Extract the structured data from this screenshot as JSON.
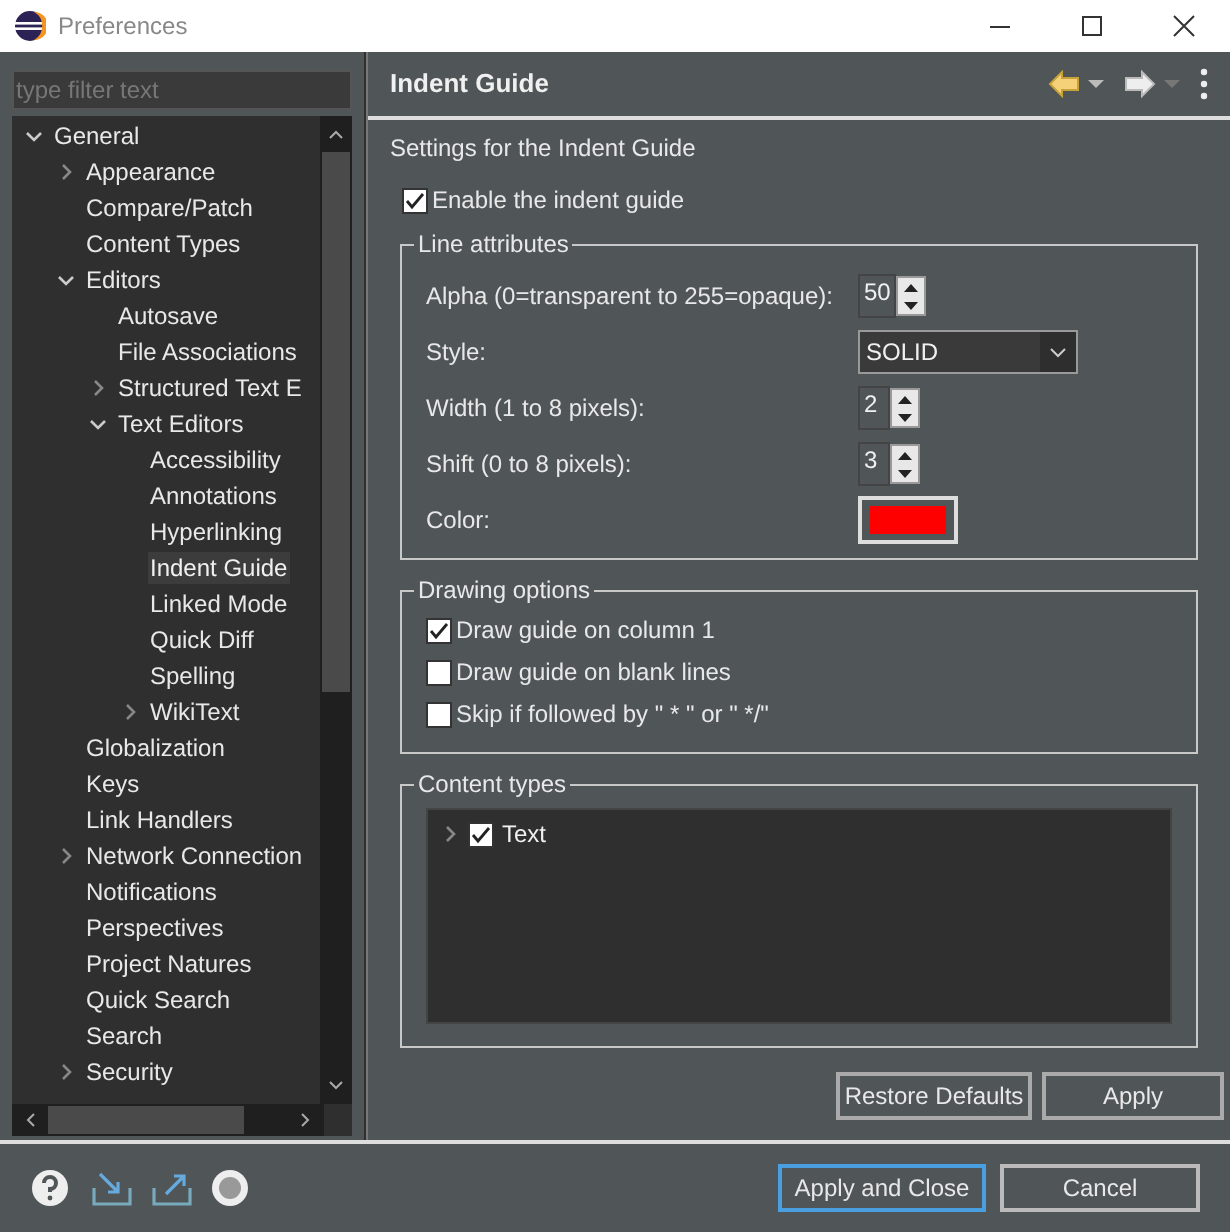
{
  "window": {
    "title": "Preferences"
  },
  "filter": {
    "placeholder": "type filter text"
  },
  "tree": [
    {
      "label": "General",
      "expanded": true,
      "selected": false,
      "children": [
        {
          "label": "Appearance",
          "expanded": false,
          "selected": false
        },
        {
          "label": "Compare/Patch",
          "selected": false
        },
        {
          "label": "Content Types",
          "selected": false
        },
        {
          "label": "Editors",
          "expanded": true,
          "selected": false,
          "children": [
            {
              "label": "Autosave",
              "selected": false
            },
            {
              "label": "File Associations",
              "selected": false
            },
            {
              "label": "Structured Text E",
              "expanded": false,
              "selected": false
            },
            {
              "label": "Text Editors",
              "expanded": true,
              "selected": false,
              "children": [
                {
                  "label": "Accessibility",
                  "selected": false
                },
                {
                  "label": "Annotations",
                  "selected": false
                },
                {
                  "label": "Hyperlinking",
                  "selected": false
                },
                {
                  "label": "Indent Guide",
                  "selected": true
                },
                {
                  "label": "Linked Mode",
                  "selected": false
                },
                {
                  "label": "Quick Diff",
                  "selected": false
                },
                {
                  "label": "Spelling",
                  "selected": false
                },
                {
                  "label": "WikiText",
                  "expanded": false,
                  "selected": false
                }
              ]
            }
          ]
        },
        {
          "label": "Globalization",
          "selected": false
        },
        {
          "label": "Keys",
          "selected": false
        },
        {
          "label": "Link Handlers",
          "selected": false
        },
        {
          "label": "Network Connection",
          "expanded": false,
          "selected": false
        },
        {
          "label": "Notifications",
          "selected": false
        },
        {
          "label": "Perspectives",
          "selected": false
        },
        {
          "label": "Project Natures",
          "selected": false
        },
        {
          "label": "Quick Search",
          "selected": false
        },
        {
          "label": "Search",
          "selected": false
        },
        {
          "label": "Security",
          "expanded": false,
          "selected": false
        }
      ]
    }
  ],
  "page": {
    "title": "Indent Guide",
    "description": "Settings for the Indent Guide",
    "enable": {
      "label": "Enable the indent guide",
      "checked": true
    },
    "line_attributes": {
      "title": "Line attributes",
      "rows": [
        {
          "kind": "spinner",
          "label": "Alpha (0=transparent to 255=opaque):",
          "value": "50"
        },
        {
          "kind": "dropdown",
          "label": "Style:",
          "value": "SOLID"
        },
        {
          "kind": "spinner",
          "label": "Width (1 to 8 pixels):",
          "value": "2"
        },
        {
          "kind": "spinner",
          "label": "Shift (0 to 8 pixels):",
          "value": "3"
        },
        {
          "kind": "color",
          "label": "Color:",
          "color": "#ff0000"
        }
      ]
    },
    "drawing_options": {
      "title": "Drawing options",
      "options": [
        {
          "label": "Draw guide on column 1",
          "checked": true
        },
        {
          "label": "Draw guide on blank lines",
          "checked": false
        },
        {
          "label": "Skip if followed by \" * \" or \" */\"",
          "checked": false
        }
      ]
    },
    "content_types": {
      "title": "Content types",
      "items": [
        {
          "label": "Text",
          "checked": true,
          "expanded": false
        }
      ]
    },
    "buttons": [
      "Restore Defaults",
      "Apply"
    ]
  },
  "footer": {
    "buttons": [
      {
        "label": "Apply and Close",
        "default": true
      },
      {
        "label": "Cancel",
        "default": false
      }
    ]
  }
}
